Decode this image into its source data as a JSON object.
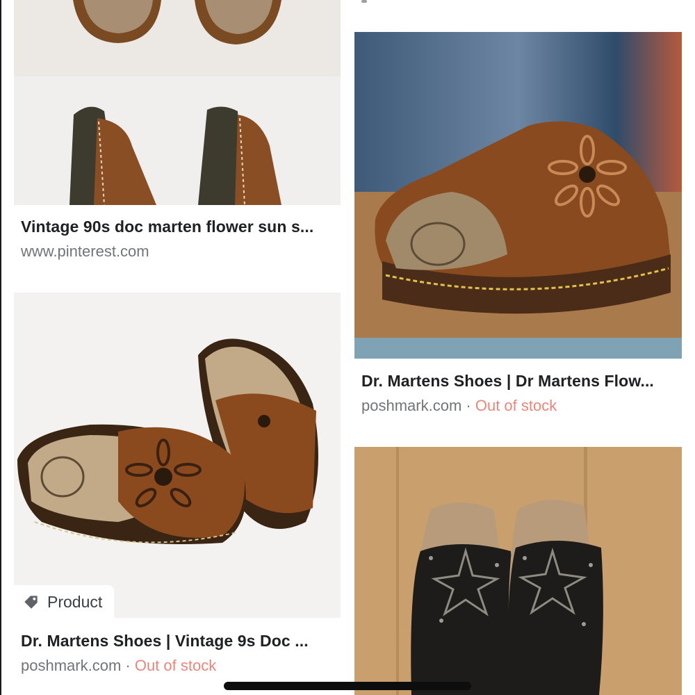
{
  "results": [
    {
      "title": "Vintage 90s doc marten flower sun s...",
      "source": "www.pinterest.com",
      "image": "brown-leather-mule-sandals-photo"
    },
    {
      "title": "Dr. Martens Shoes | Dr Martens Flow...",
      "source": "poshmark.com",
      "separator": "·",
      "stock": "Out of stock",
      "image": "brown-flower-clog-on-wood-photo"
    },
    {
      "title": "Dr. Martens Shoes | Vintage 9s Doc ...",
      "source": "poshmark.com",
      "separator": "·",
      "stock": "Out of stock",
      "badge": "Product",
      "badge_icon": "tag-icon",
      "image": "brown-flower-slide-sandals-photo"
    },
    {
      "image": "black-star-slide-sandals-photo"
    }
  ],
  "colors": {
    "title": "#202124",
    "source": "#70757a",
    "out_of_stock": "#e8867c"
  }
}
